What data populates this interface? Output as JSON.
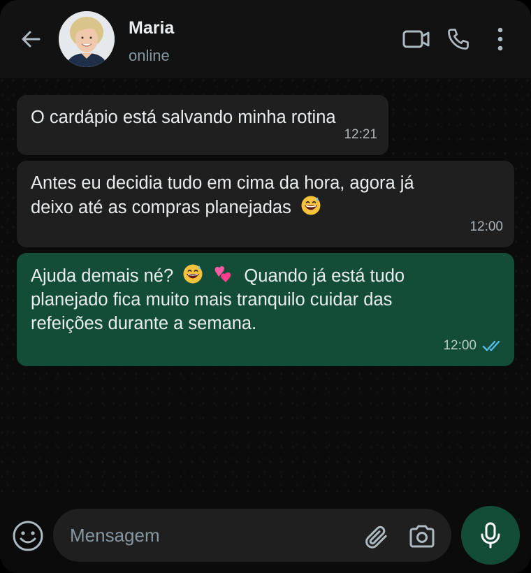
{
  "header": {
    "contact_name": "Maria",
    "contact_status": "online"
  },
  "messages": [
    {
      "direction": "incoming",
      "text": "O cardápio está salvando minha rotina",
      "time": "12:21"
    },
    {
      "direction": "incoming",
      "text_line1": "Antes eu decidia tudo em cima da hora, agora já",
      "text_line2": "deixo até as compras planejadas",
      "emoji": "grinning-sweat-emoji",
      "time": "12:00"
    },
    {
      "direction": "outgoing",
      "text_part1": "Ajuda demais né?",
      "emojis": [
        "grinning-sweat-emoji",
        "two-hearts-emoji"
      ],
      "text_part2": "Quando já está tudo",
      "text_line2": "planejado fica muito mais tranquilo cuidar das",
      "text_line3": "refeições durante a semana.",
      "time": "12:00",
      "status": "read"
    }
  ],
  "composer": {
    "placeholder": "Mensagem"
  },
  "colors": {
    "background": "#0b0b0b",
    "header": "#121212",
    "incoming_bubble": "#1f1f1f",
    "outgoing_bubble": "#134d37",
    "read_ticks": "#53bdeb",
    "icon": "#aebac1"
  },
  "icons": [
    "back-arrow-icon",
    "video-call-icon",
    "voice-call-icon",
    "more-options-icon",
    "emoji-icon",
    "attach-icon",
    "camera-icon",
    "mic-icon"
  ]
}
